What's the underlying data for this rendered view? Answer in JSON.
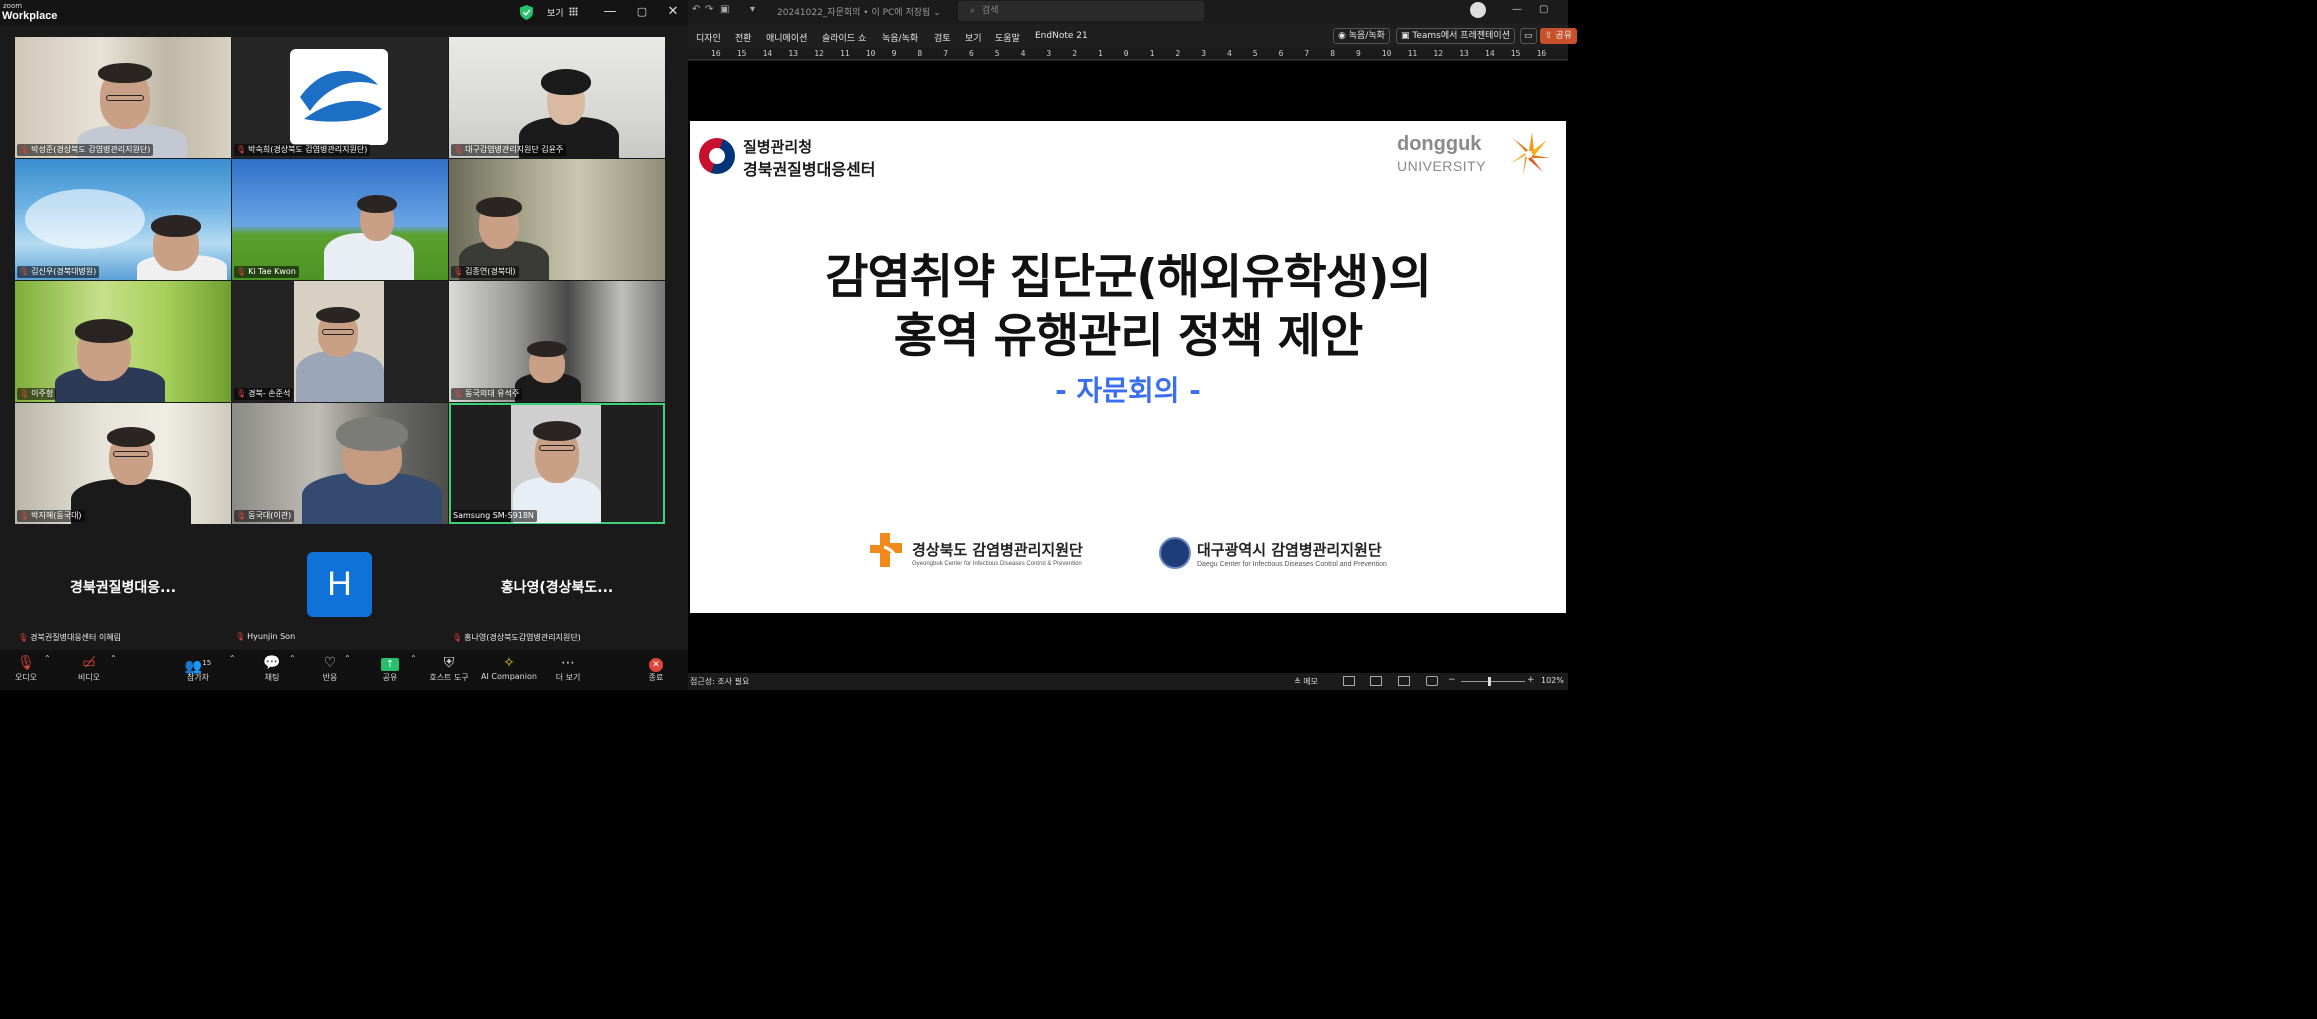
{
  "zoom": {
    "app_small": "zoom",
    "app_name": "Workplace",
    "view_label": "보기",
    "tiles": [
      {
        "name": "박성준(경상북도 감염병관리지원단)"
      },
      {
        "name": "박숙희(경상북도 감염병관리지원단)"
      },
      {
        "name": "대구감염병관리지원단 김윤주"
      },
      {
        "name": "김신우(경북대병원)"
      },
      {
        "name": "Ki Tae Kwon"
      },
      {
        "name": "김종연(경북대)"
      },
      {
        "name": "이주형"
      },
      {
        "name": "경북- 손준석"
      },
      {
        "name": "동국의대 유석주"
      },
      {
        "name": "박지혜(동국대)"
      },
      {
        "name": "동국대(이관)"
      },
      {
        "name": "Samsung SM-S918N"
      }
    ],
    "audio_tiles": [
      {
        "display": "경북권질병대응...",
        "name": "경북권질병대응센터 이혜림"
      },
      {
        "display": "H",
        "name": "Hyunjin Son"
      },
      {
        "display": "홍나영(경상북도...",
        "name": "홍나영(경상북도감염병관리지원단)"
      }
    ],
    "toolbar": {
      "audio": "오디오",
      "video": "비디오",
      "participants": "참가자",
      "participants_count": "15",
      "chat": "채팅",
      "reactions": "반응",
      "share": "공유",
      "host_tools": "호스트 도구",
      "ai_companion": "AI Companion",
      "more": "더 보기",
      "end": "종료"
    }
  },
  "ppt": {
    "doc_title": "20241022_자문회의 • 이 PC에 저장됨 ⌄",
    "search_placeholder": "검색",
    "menus": [
      "디자인",
      "전환",
      "애니메이션",
      "슬라이드 쇼",
      "녹음/녹화",
      "검토",
      "보기",
      "도움말",
      "EndNote 21"
    ],
    "record_btn": "녹음/녹화",
    "teams_btn": "Teams에서 프레젠테이션",
    "share_btn": "공유",
    "ruler": [
      "16",
      "15",
      "14",
      "13",
      "12",
      "11",
      "10",
      "9",
      "8",
      "7",
      "6",
      "5",
      "4",
      "3",
      "2",
      "1",
      "0",
      "1",
      "2",
      "3",
      "4",
      "5",
      "6",
      "7",
      "8",
      "9",
      "10",
      "11",
      "12",
      "13",
      "14",
      "15",
      "16"
    ],
    "slide": {
      "org_line1": "질병관리청",
      "org_line2": "경북권질병대응센터",
      "univ_name": "dongguk",
      "univ_sub": "UNIVERSITY",
      "title_line1": "감염취약 집단군(해외유학생)의",
      "title_line2": "홍역 유행관리 정책 제안",
      "subtitle": "- 자문회의 -",
      "gb_name": "경상북도 감염병관리지원단",
      "gb_en": "Gyeongbuk Center for Infectious Diseases Control & Prevention",
      "dg_name": "대구광역시 감염병관리지원단",
      "dg_en": "Daegu Center for Infectious Diseases Control and Prevention"
    },
    "status": {
      "accessibility": "접근성: 조사 필요",
      "notes": "메모",
      "zoom_level": "102%"
    }
  }
}
